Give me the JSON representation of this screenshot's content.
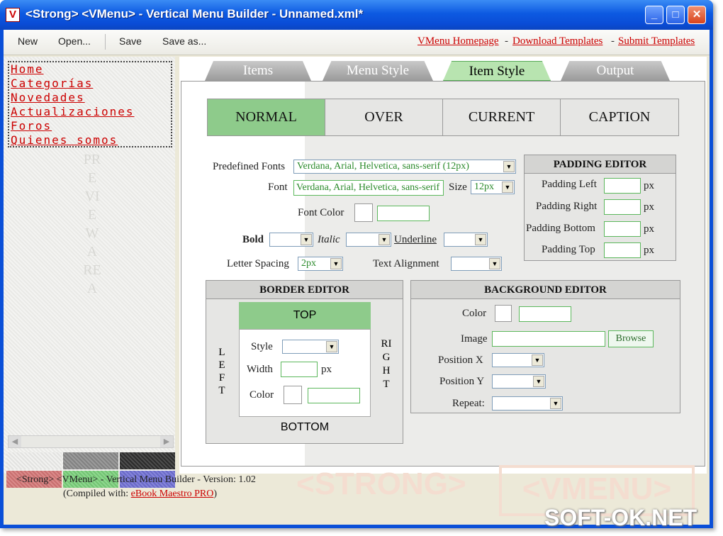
{
  "window": {
    "title": "<Strong> <VMenu> - Vertical Menu Builder - Unnamed.xml*",
    "icon": "V"
  },
  "toolbar": {
    "new": "New",
    "open": "Open...",
    "save": "Save",
    "save_as": "Save as..."
  },
  "links": {
    "homepage": "VMenu Homepage",
    "download": "Download Templates",
    "submit": "Submit Templates",
    "sep": "-"
  },
  "preview": {
    "items": [
      "Home",
      "Categorías",
      "Novedades",
      "Actualizaciones",
      "Foros",
      "Quienes somos"
    ],
    "vertical_text": "PREVIEW AREA"
  },
  "swatches": [
    "#f0f0ee",
    "#8a8a8a",
    "#2e2e2e",
    "#d47676",
    "#7ad07a",
    "#7070d4"
  ],
  "tabs": {
    "items": "Items",
    "menu_style": "Menu Style",
    "item_style": "Item Style",
    "output": "Output",
    "active": "Item Style"
  },
  "states": {
    "normal": "NORMAL",
    "over": "OVER",
    "current": "CURRENT",
    "caption": "CAPTION",
    "selected": "NORMAL"
  },
  "fonts": {
    "predefined_label": "Predefined Fonts",
    "predefined_value": "Verdana, Arial, Helvetica, sans-serif (12px)",
    "font_label": "Font",
    "font_value": "Verdana, Arial, Helvetica, sans-serif",
    "size_label": "Size",
    "size_value": "12px",
    "color_label": "Font Color",
    "bold_label": "Bold",
    "italic_label": "Italic",
    "underline_label": "Underline",
    "spacing_label": "Letter Spacing",
    "spacing_value": "2px",
    "align_label": "Text Alignment"
  },
  "padding": {
    "title": "PADDING EDITOR",
    "left": "Padding Left",
    "right": "Padding Right",
    "bottom": "Padding Bottom",
    "top": "Padding Top",
    "unit": "px"
  },
  "border": {
    "title": "BORDER EDITOR",
    "top": "TOP",
    "bottom": "BOTTOM",
    "left": "LEFT",
    "right": "RIGHT",
    "style": "Style",
    "width": "Width",
    "color": "Color",
    "unit": "px"
  },
  "background": {
    "title": "BACKGROUND EDITOR",
    "color": "Color",
    "image": "Image",
    "browse": "Browse",
    "pos_x": "Position X",
    "pos_y": "Position Y",
    "repeat": "Repeat:"
  },
  "status": {
    "line1": "<Strong> <VMenu> - Vertical Menu Builder - Version: 1.02",
    "compiled_prefix": "(Compiled with: ",
    "compiled_link": "eBook Maestro PRO",
    "compiled_suffix": ")"
  },
  "watermark": {
    "brand": "<STRONG>",
    "vmenu": "<VMENU>",
    "site": "SOFT-OK.NET"
  }
}
